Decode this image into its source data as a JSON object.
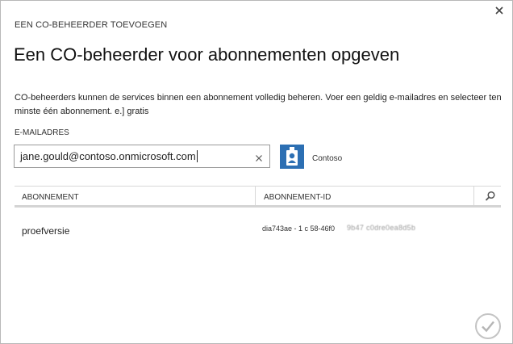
{
  "dialog": {
    "header": "EEN CO-BEHEERDER TOEVOEGEN",
    "title": "Een CO-beheerder voor abonnementen opgeven",
    "description": "CO-beheerders kunnen de services binnen een abonnement volledig beheren. Voer een geldig e-mailadres en selecteer ten minste één abonnement. e.] gratis"
  },
  "email": {
    "label": "E-MAILADRES",
    "value": "jane.gould@contoso.onmicrosoft.com"
  },
  "organization": {
    "name": "Contoso",
    "tile_color": "#2c6fb3"
  },
  "table": {
    "columns": [
      "ABONNEMENT",
      "ABONNEMENT-ID"
    ],
    "rows": [
      {
        "name": "proefversie",
        "id": "dia743ae - 1 c 58-46f0",
        "id_hidden": "9b47 c0dre0ea8d5b"
      }
    ]
  },
  "icons": {
    "close": "close-icon",
    "clear": "clear-icon",
    "search": "search-icon",
    "confirm": "checkmark-icon"
  }
}
